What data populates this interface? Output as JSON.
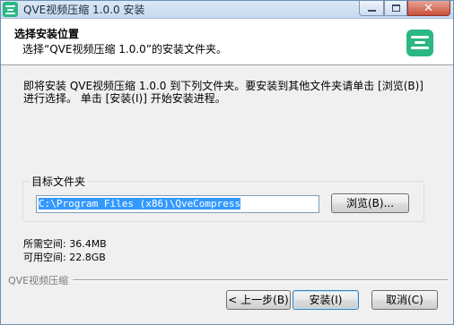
{
  "window": {
    "title": "QVE视频压缩 1.0.0 安装",
    "close_glyph": "✕"
  },
  "header": {
    "title": "选择安装位置",
    "subtitle": "选择“QVE视频压缩 1.0.0”的安装文件夹。"
  },
  "body": {
    "intro": "即将安装 QVE视频压缩 1.0.0 到下列文件夹。要安装到其他文件夹请单击 [浏览(B)]\n进行选择。 单击 [安装(I)] 开始安装进程。"
  },
  "destination": {
    "legend": "目标文件夹",
    "path": "C:\\Program Files (x86)\\QveCompress",
    "browse_label": "浏览(B)..."
  },
  "space": {
    "required": "所需空间: 36.4MB",
    "available": "可用空间: 22.8GB"
  },
  "footer": {
    "brand": "QVE视频压缩",
    "back_label": "< 上一步(B)",
    "install_label": "安装(I)",
    "cancel_label": "取消(C)"
  },
  "colors": {
    "brand_green": "#2bb783",
    "selection_blue": "#3399ff"
  }
}
